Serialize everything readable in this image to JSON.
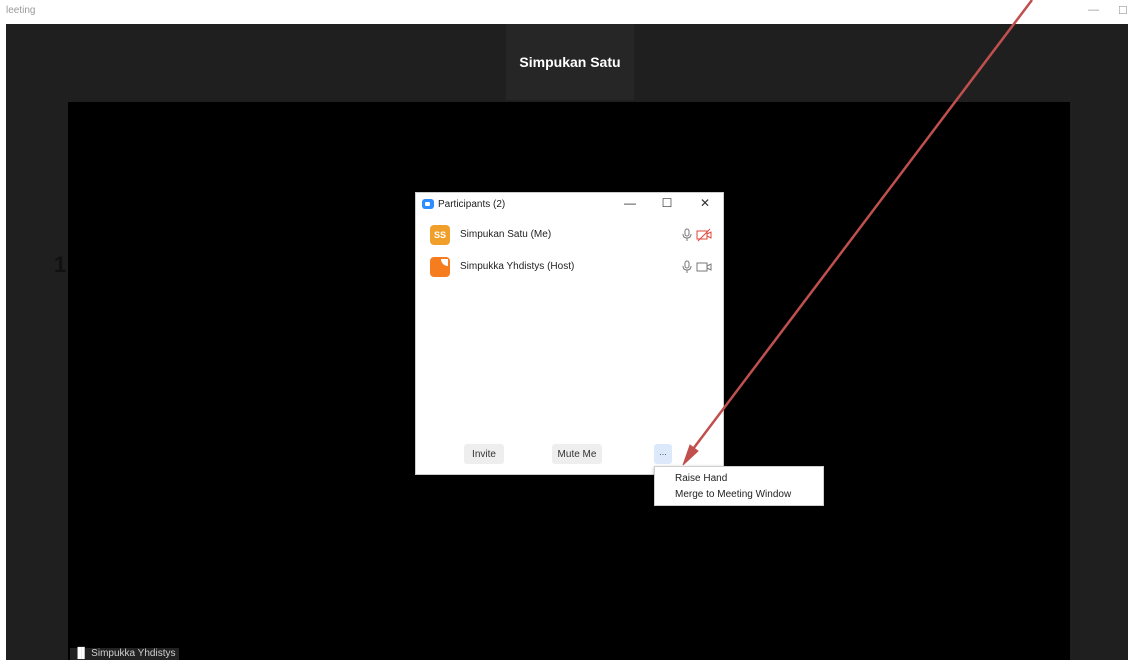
{
  "window": {
    "title": "leeting",
    "min_glyph": "—",
    "max_glyph": "☐"
  },
  "speaker": {
    "name": "Simpukan Satu"
  },
  "edge_number": "1",
  "bottom_label": {
    "bars": "▐▌",
    "name": "Simpukka Yhdistys"
  },
  "participants_panel": {
    "title": "Participants (2)",
    "controls": {
      "minimize": "—",
      "maximize": "☐",
      "close": "✕"
    },
    "participants": [
      {
        "initials": "SS",
        "name": "Simpukan Satu (Me)",
        "mic": "on",
        "video": "off"
      },
      {
        "initials": "",
        "name": "Simpukka Yhdistys (Host)",
        "mic": "on",
        "video": "on"
      }
    ],
    "buttons": {
      "invite": "Invite",
      "mute_me": "Mute Me",
      "more": "..."
    }
  },
  "context_menu": {
    "items": [
      "Raise Hand",
      "Merge to Meeting Window"
    ]
  },
  "colors": {
    "stage_bg": "#1f1f1f",
    "video_bg": "#000000",
    "avatar_me": "#f09f2a",
    "avatar_host": "#f57c1f",
    "zoom_blue": "#2d8cff",
    "video_off_red": "#e0463a",
    "annotation_arrow": "#c0504d"
  }
}
